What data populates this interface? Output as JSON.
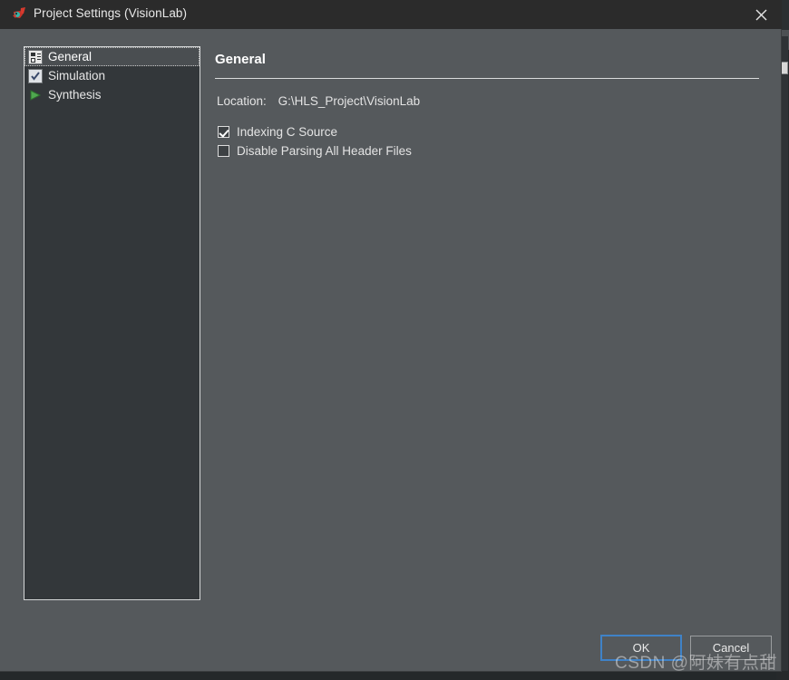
{
  "window": {
    "title": "Project Settings (VisionLab)",
    "icon": "vivado-hls-icon",
    "close_label": "×"
  },
  "sidebar": {
    "items": [
      {
        "label": "General",
        "icon": "properties-icon",
        "selected": true
      },
      {
        "label": "Simulation",
        "icon": "checkbox-check-icon",
        "selected": false
      },
      {
        "label": "Synthesis",
        "icon": "green-play-icon",
        "selected": false
      }
    ]
  },
  "main": {
    "title": "General",
    "location": {
      "label": "Location:",
      "value": "G:\\HLS_Project\\VisionLab"
    },
    "checkboxes": [
      {
        "label": "Indexing C Source",
        "checked": true
      },
      {
        "label": "Disable Parsing All Header Files",
        "checked": false
      }
    ]
  },
  "footer": {
    "ok_label": "OK",
    "cancel_label": "Cancel"
  },
  "watermark": {
    "text": "CSDN @阿妹有点甜"
  },
  "colors": {
    "dialog_bg": "#55595c",
    "titlebar_bg": "#2b2b2b",
    "tree_bg": "#33373a",
    "accent_focus": "#3f82c7",
    "text": "#e4e4e4",
    "synthesis_green": "#4fa84f"
  }
}
